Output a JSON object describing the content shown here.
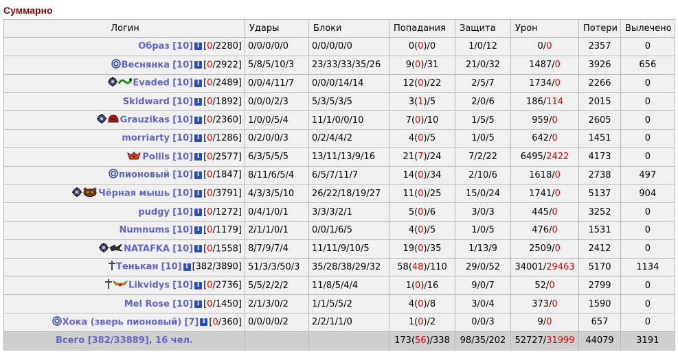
{
  "title": "Суммарно",
  "headers": [
    "Логин",
    "Удары",
    "Блоки",
    "Попадания",
    "Защита",
    "Урон",
    "Потери",
    "Вылечено"
  ],
  "rows": [
    {
      "icons": [],
      "name": "Образ",
      "level": "[10]",
      "hp_cur": "0",
      "hp_max": "/2280",
      "hits": "0/0/0/0/0",
      "blocks": "0/0/0/0/0",
      "hit_a": "0(",
      "hit_b": "0",
      "hit_c": ")/0",
      "defense": "1/0/12",
      "dmg_a": "0/",
      "dmg_b": "0",
      "losses": "2357",
      "healed": "0"
    },
    {
      "icons": [
        "swirl-icon"
      ],
      "name": "Веснянка",
      "level": "[10]",
      "hp_cur": "0",
      "hp_max": "/2922",
      "hits": "5/8/5/10/3",
      "blocks": "23/33/33/35/26",
      "hit_a": "9(",
      "hit_b": "0",
      "hit_c": ")/31",
      "defense": "21/0/32",
      "dmg_a": "1487/",
      "dmg_b": "0",
      "losses": "3926",
      "healed": "656"
    },
    {
      "icons": [
        "gear-icon",
        "snake-icon"
      ],
      "name": "Evaded",
      "level": "[10]",
      "hp_cur": "0",
      "hp_max": "/2489",
      "hits": "0/0/4/11/7",
      "blocks": "0/0/0/14/14",
      "hit_a": "12(",
      "hit_b": "0",
      "hit_c": ")/22",
      "defense": "2/5/7",
      "dmg_a": "1734/",
      "dmg_b": "0",
      "losses": "2266",
      "healed": "0"
    },
    {
      "icons": [],
      "name": "Skidward",
      "level": "[10]",
      "hp_cur": "0",
      "hp_max": "/1892",
      "hits": "0/0/0/2/3",
      "blocks": "5/3/5/3/5",
      "hit_a": "3(",
      "hit_b": "1",
      "hit_c": ")/5",
      "defense": "2/0/6",
      "dmg_a": "186/",
      "dmg_b": "114",
      "losses": "2015",
      "healed": "0"
    },
    {
      "icons": [
        "gear-icon",
        "helmet-icon"
      ],
      "name": "Grauzikas",
      "level": "[10]",
      "hp_cur": "0",
      "hp_max": "/2360",
      "hits": "1/0/0/5/4",
      "blocks": "11/1/0/0/10",
      "hit_a": "7(",
      "hit_b": "0",
      "hit_c": ")/10",
      "defense": "1/5/5",
      "dmg_a": "959/",
      "dmg_b": "0",
      "losses": "2605",
      "healed": "0"
    },
    {
      "icons": [],
      "name": "morriarty",
      "level": "[10]",
      "hp_cur": "0",
      "hp_max": "/1286",
      "hits": "0/2/0/0/3",
      "blocks": "0/2/4/4/2",
      "hit_a": "4(",
      "hit_b": "0",
      "hit_c": ")/5",
      "defense": "1/0/5",
      "dmg_a": "642/",
      "dmg_b": "0",
      "losses": "1451",
      "healed": "0"
    },
    {
      "icons": [
        "fox-icon"
      ],
      "name": "Pollis",
      "level": "[10]",
      "hp_cur": "0",
      "hp_max": "/2577",
      "hits": "6/3/5/5/5",
      "blocks": "13/11/13/9/16",
      "hit_a": "21(",
      "hit_b": "7",
      "hit_c": ")/24",
      "defense": "7/2/22",
      "dmg_a": "6495/",
      "dmg_b": "2422",
      "losses": "4173",
      "healed": "0"
    },
    {
      "icons": [
        "swirl-icon"
      ],
      "name": "пионовый",
      "level": "[10]",
      "hp_cur": "0",
      "hp_max": "/1847",
      "hits": "8/11/6/5/4",
      "blocks": "6/5/7/11/7",
      "hit_a": "14(",
      "hit_b": "0",
      "hit_c": ")/34",
      "defense": "2/10/6",
      "dmg_a": "1618/",
      "dmg_b": "0",
      "losses": "2738",
      "healed": "497"
    },
    {
      "icons": [
        "gear-icon",
        "bear-icon"
      ],
      "name": "Чёрная мышь",
      "level": "[10]",
      "hp_cur": "0",
      "hp_max": "/3791",
      "hits": "4/3/3/5/10",
      "blocks": "26/22/18/19/27",
      "hit_a": "11(",
      "hit_b": "0",
      "hit_c": ")/25",
      "defense": "15/0/24",
      "dmg_a": "1741/",
      "dmg_b": "0",
      "losses": "5137",
      "healed": "904"
    },
    {
      "icons": [],
      "name": "pudgy",
      "level": "[10]",
      "hp_cur": "0",
      "hp_max": "/1272",
      "hits": "0/4/1/0/1",
      "blocks": "3/3/3/2/1",
      "hit_a": "5(",
      "hit_b": "0",
      "hit_c": ")/6",
      "defense": "3/0/3",
      "dmg_a": "445/",
      "dmg_b": "0",
      "losses": "3252",
      "healed": "0"
    },
    {
      "icons": [],
      "name": "Numnums",
      "level": "[10]",
      "hp_cur": "0",
      "hp_max": "/1179",
      "hits": "2/1/1/0/1",
      "blocks": "0/0/1/6/5",
      "hit_a": "4(",
      "hit_b": "0",
      "hit_c": ")/5",
      "defense": "1/0/5",
      "dmg_a": "476/",
      "dmg_b": "0",
      "losses": "1531",
      "healed": "0"
    },
    {
      "icons": [
        "gear-icon",
        "bird-icon"
      ],
      "name": "NATAFKA",
      "level": "[10]",
      "hp_cur": "0",
      "hp_max": "/1558",
      "hits": "8/7/9/7/4",
      "blocks": "11/11/9/10/5",
      "hit_a": "19(",
      "hit_b": "0",
      "hit_c": ")/35",
      "defense": "1/13/9",
      "dmg_a": "2509/",
      "dmg_b": "0",
      "losses": "2412",
      "healed": "0"
    },
    {
      "icons": [
        "cross-icon"
      ],
      "name": "Тенькан",
      "level": "[10]",
      "hp_cur": "",
      "hp_max": "382/3890",
      "hits": "51/3/3/50/3",
      "blocks": "35/28/38/29/32",
      "hit_a": "58(",
      "hit_b": "48",
      "hit_c": ")/110",
      "defense": "29/0/52",
      "dmg_a": "34001/",
      "dmg_b": "29463",
      "losses": "5170",
      "healed": "1134"
    },
    {
      "icons": [
        "cross-icon",
        "wings-icon"
      ],
      "name": "Likvidys",
      "level": "[10]",
      "hp_cur": "0",
      "hp_max": "/2736",
      "hits": "5/5/2/2/2",
      "blocks": "11/8/5/4/4",
      "hit_a": "1(",
      "hit_b": "0",
      "hit_c": ")/16",
      "defense": "9/0/7",
      "dmg_a": "52/",
      "dmg_b": "0",
      "losses": "2799",
      "healed": "0"
    },
    {
      "icons": [],
      "name": "Mel Rose",
      "level": "[10]",
      "hp_cur": "0",
      "hp_max": "/1450",
      "hits": "2/1/3/0/2",
      "blocks": "1/1/5/5/2",
      "hit_a": "4(",
      "hit_b": "0",
      "hit_c": ")/8",
      "defense": "3/0/4",
      "dmg_a": "373/",
      "dmg_b": "0",
      "losses": "1590",
      "healed": "0"
    },
    {
      "icons": [
        "swirl-icon"
      ],
      "name": "Хока (зверь пионовый)",
      "level": "[7]",
      "hp_cur": "0",
      "hp_max": "/360",
      "hits": "0/0/0/0/2",
      "blocks": "2/2/1/1/0",
      "hit_a": "1(",
      "hit_b": "0",
      "hit_c": ")/2",
      "defense": "0/0/3",
      "dmg_a": "9/",
      "dmg_b": "0",
      "losses": "657",
      "healed": "0"
    }
  ],
  "total": {
    "label": "Всего [382/33889], 16 чел.",
    "hit_a": "173(",
    "hit_b": "56",
    "hit_c": ")/338",
    "defense": "98/35/202",
    "dmg_a": "52727/",
    "dmg_b": "31999",
    "losses": "44079",
    "healed": "3191"
  },
  "colors": {
    "title": "#8b0000",
    "name": "#6464c8",
    "alert": "#e00000",
    "info": "#2a4fb8"
  }
}
